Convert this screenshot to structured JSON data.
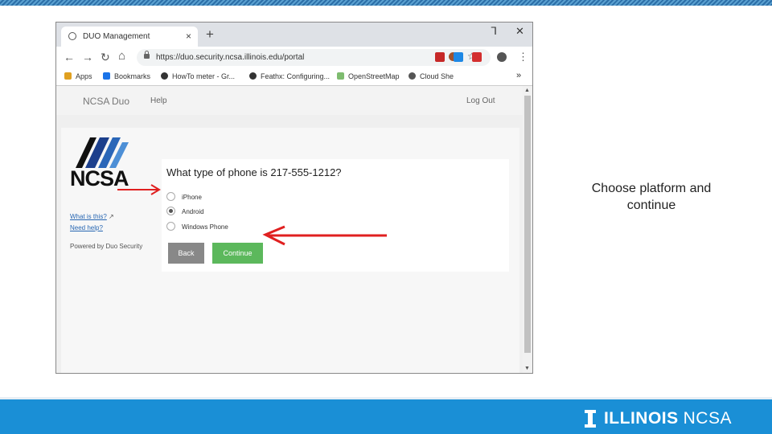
{
  "browser": {
    "tab_title": "DUO Management",
    "tab_close": "×",
    "new_tab": "+",
    "minimize": "ᒣ",
    "close": "✕",
    "back": "←",
    "forward": "→",
    "reload": "↻",
    "home": "⌂",
    "url": "https://duo.security.ncsa.illinois.edu/portal",
    "star": "☆",
    "menu": "⋮",
    "bookmarks": [
      {
        "label": "Apps",
        "icon_color": "#e0a020"
      },
      {
        "label": "Bookmarks",
        "icon_color": "#1a73e8"
      },
      {
        "label": "HowTo meter - Gr...",
        "icon_color": "#333333"
      },
      {
        "label": "Feathx: Configuring...",
        "icon_color": "#333333"
      },
      {
        "label": "OpenStreetMap",
        "icon_color": "#7ebc6f"
      },
      {
        "label": "Cloud She",
        "icon_color": "#555555"
      }
    ],
    "bookmarks_overflow": "»"
  },
  "site": {
    "brand": "NCSA Duo",
    "help": "Help",
    "logout": "Log Out"
  },
  "duo": {
    "logo_text": "NCSA",
    "what_is_this": "What is this?",
    "need_help": "Need help?",
    "powered_by": "Powered by Duo Security",
    "question": "What type of phone is 217-555-1212?",
    "options": [
      {
        "label": "iPhone",
        "selected": false
      },
      {
        "label": "Android",
        "selected": true
      },
      {
        "label": "Windows Phone",
        "selected": false
      }
    ],
    "back_label": "Back",
    "continue_label": "Continue"
  },
  "slide": {
    "caption": "Choose platform and continue",
    "footer_brand_1": "ILLINOIS",
    "footer_brand_2": "NCSA"
  },
  "colors": {
    "footer_band": "#1a8fd6",
    "continue_button": "#5cb85c",
    "back_button": "#888888",
    "arrow": "#e02020"
  }
}
